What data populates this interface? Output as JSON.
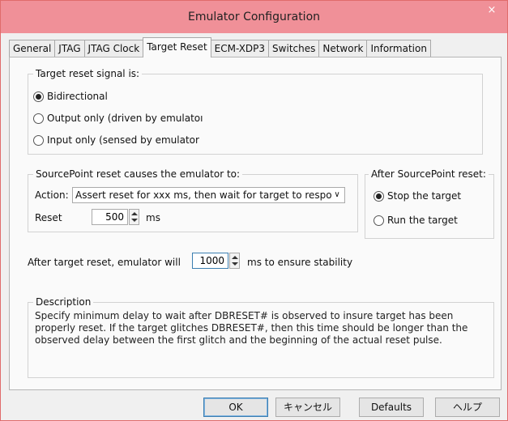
{
  "window": {
    "title": "Emulator Configuration",
    "close_glyph": "×"
  },
  "tabs": [
    "General",
    "JTAG",
    "JTAG Clock",
    "Target Reset",
    "ECM-XDP3",
    "Switches",
    "Network",
    "Information"
  ],
  "active_tab": "Target Reset",
  "reset_signal": {
    "legend": "Target reset signal is:",
    "options": [
      {
        "label": "Bidirectional",
        "checked": true
      },
      {
        "label": "Output only (driven by emulatoı",
        "checked": false
      },
      {
        "label": "Input only (sensed by emulator",
        "checked": false
      }
    ]
  },
  "sourcepoint_reset": {
    "legend": "SourcePoint reset causes the emulator to:",
    "action_label": "Action:",
    "action_value": "Assert reset for xxx ms, then wait for target to respo",
    "reset_label": "Reset",
    "reset_value": "500",
    "reset_unit": "ms"
  },
  "after_reset": {
    "legend": "After SourcePoint reset:",
    "options": [
      {
        "label": "Stop the target",
        "checked": true
      },
      {
        "label": "Run the target",
        "checked": false
      }
    ]
  },
  "stability": {
    "prefix": "After target reset, emulator will",
    "value": "1000",
    "suffix": "ms to ensure stability"
  },
  "description": {
    "legend": "Description",
    "text": "Specify minimum delay to wait after DBRESET# is observed to insure target has been properly reset. If the target glitches DBRESET#, then this time should be longer than the observed delay between the first glitch and the beginning of the actual reset pulse."
  },
  "buttons": {
    "ok": "OK",
    "cancel": "キャンセル",
    "defaults": "Defaults",
    "help": "ヘルプ"
  }
}
